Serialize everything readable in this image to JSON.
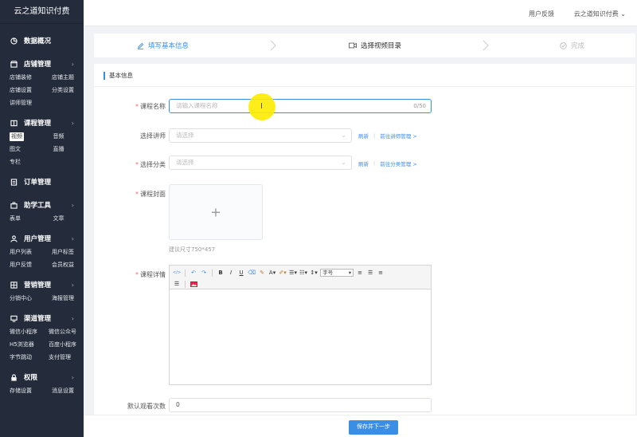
{
  "sidebar": {
    "brand": "云之道知识付费",
    "groups": [
      {
        "title": "数据概况",
        "icon": "chart-pie-icon",
        "chevron": false,
        "items": []
      },
      {
        "title": "店铺管理",
        "icon": "store-icon",
        "chevron": true,
        "items": [
          "店铺装修",
          "店铺主题",
          "店铺设置",
          "分类设置",
          "讲师管理"
        ]
      },
      {
        "title": "课程管理",
        "icon": "book-icon",
        "chevron": true,
        "items": [
          "视频",
          "音频",
          "图文",
          "直播",
          "专栏"
        ]
      },
      {
        "title": "订单管理",
        "icon": "order-icon",
        "chevron": false,
        "items": []
      },
      {
        "title": "助学工具",
        "icon": "toolbox-icon",
        "chevron": true,
        "items": [
          "表单",
          "文章"
        ]
      },
      {
        "title": "用户管理",
        "icon": "user-icon",
        "chevron": true,
        "items": [
          "用户列表",
          "用户标签",
          "用户反馈",
          "会员权益"
        ]
      },
      {
        "title": "营销管理",
        "icon": "marketing-icon",
        "chevron": true,
        "items": [
          "分销中心",
          "海报管理"
        ]
      },
      {
        "title": "渠道管理",
        "icon": "monitor-icon",
        "chevron": true,
        "items": [
          "微信小程序",
          "微信公众号",
          "H5浏览器",
          "百度小程序",
          "字节跳动",
          "支付管理"
        ]
      },
      {
        "title": "权限",
        "icon": "lock-icon",
        "chevron": true,
        "items": [
          "存储设置",
          "消息设置"
        ]
      }
    ],
    "active_item": "视频"
  },
  "topbar": {
    "feedback": "用户反馈",
    "user": "云之道知识付费"
  },
  "steps": [
    {
      "label": "填写基本信息",
      "state": "active",
      "icon": "edit-icon"
    },
    {
      "label": "选择视频目录",
      "state": "pending",
      "icon": "video-icon"
    },
    {
      "label": "完成",
      "state": "disabled",
      "icon": "check-circle-icon"
    }
  ],
  "form": {
    "section_title": "基本信息",
    "course_name": {
      "label": "课程名称",
      "placeholder": "请输入课程名称",
      "count": "0/50"
    },
    "lecturer": {
      "label": "选择讲师",
      "placeholder": "请选择",
      "refresh": "刷新",
      "manage": "前往讲师管理 >"
    },
    "category": {
      "label": "选择分类",
      "placeholder": "请选择",
      "refresh": "刷新",
      "manage": "前往分类管理 >"
    },
    "cover": {
      "label": "课程封面",
      "hint": "建议尺寸750*457"
    },
    "detail": {
      "label": "课程详情",
      "font_select": "字号"
    },
    "views": {
      "label": "默认观看次数",
      "value": "0"
    }
  },
  "footer": {
    "save_next": "保存并下一步"
  },
  "colors": {
    "accent": "#3a8ee6",
    "sidebar_bg": "#242c3b",
    "required": "#f56c6c"
  }
}
